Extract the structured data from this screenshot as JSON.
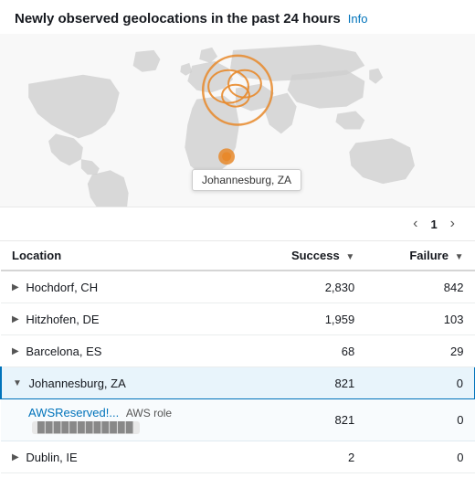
{
  "header": {
    "title": "Newly observed geolocations in the past 24 hours",
    "info_label": "Info"
  },
  "pagination": {
    "prev_label": "‹",
    "next_label": "›",
    "current_page": "1"
  },
  "table": {
    "columns": [
      {
        "key": "location",
        "label": "Location",
        "sortable": false
      },
      {
        "key": "success",
        "label": "Success",
        "sortable": true
      },
      {
        "key": "failure",
        "label": "Failure",
        "sortable": true
      }
    ],
    "rows": [
      {
        "id": "row-1",
        "location": "Hochdorf, CH",
        "success": "2,830",
        "failure": "842",
        "expanded": false,
        "selected": false
      },
      {
        "id": "row-2",
        "location": "Hitzhofen, DE",
        "success": "1,959",
        "failure": "103",
        "expanded": false,
        "selected": false
      },
      {
        "id": "row-3",
        "location": "Barcelona, ES",
        "success": "68",
        "failure": "29",
        "expanded": false,
        "selected": false
      },
      {
        "id": "row-4",
        "location": "Johannesburg, ZA",
        "success": "821",
        "failure": "0",
        "expanded": true,
        "selected": true
      },
      {
        "id": "row-5",
        "location": "Dublin, IE",
        "success": "2",
        "failure": "0",
        "expanded": false,
        "selected": false
      }
    ],
    "sub_row": {
      "aws_link": "AWSReserved!...",
      "role_label": "AWS role",
      "role_value": "████████████",
      "success": "821",
      "failure": "0"
    }
  },
  "map_tooltip": "Johannesburg, ZA",
  "colors": {
    "accent": "#e8892b",
    "link": "#0073bb",
    "selected_border": "#0073bb",
    "selected_bg": "#e8f4fb"
  }
}
